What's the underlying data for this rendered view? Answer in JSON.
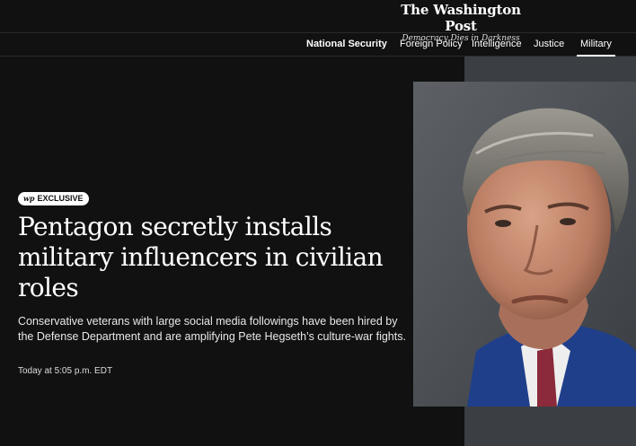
{
  "masthead": {
    "title": "The Washington Post",
    "tagline": "Democracy Dies in Darkness"
  },
  "nav": {
    "items": [
      {
        "label": "National Security"
      },
      {
        "label": "Foreign Policy"
      },
      {
        "label": "Intelligence"
      },
      {
        "label": "Justice"
      },
      {
        "label": "Military"
      }
    ]
  },
  "article": {
    "badge_logo": "wp",
    "badge_label": "EXCLUSIVE",
    "headline": "Pentagon secretly installs military influencers in civilian roles",
    "dek": "Conservative veterans with large social media followings have been hired by the Defense Department and are amplifying Pete Hegseth’s culture-war fights.",
    "timestamp": "Today at 5:05 p.m. EDT"
  },
  "colors": {
    "background": "#111111",
    "text": "#ffffff",
    "suit": "#1f3f8a",
    "tie": "#8a2a3a"
  }
}
